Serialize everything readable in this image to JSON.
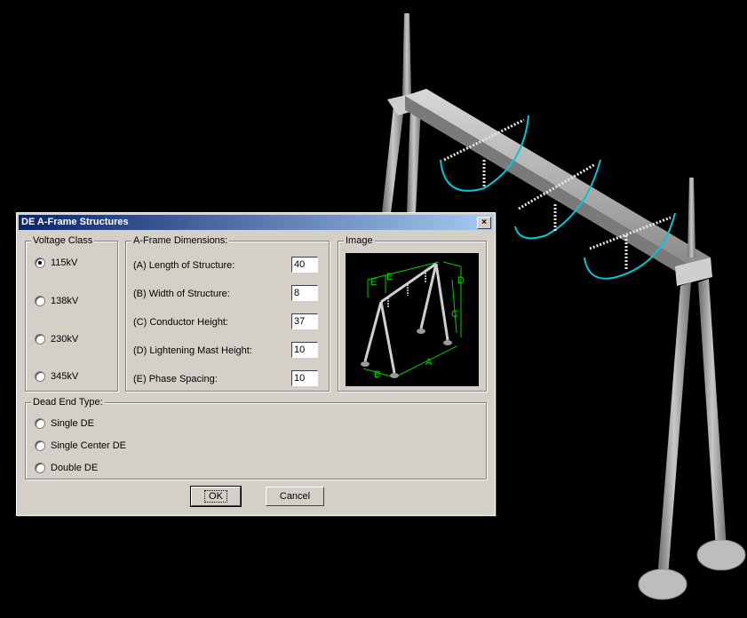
{
  "dialog": {
    "title": "DE A-Frame Structures",
    "close_glyph": "×",
    "voltage_class": {
      "label": "Voltage Class",
      "options": [
        "115kV",
        "138kV",
        "230kV",
        "345kV"
      ],
      "selected": "115kV"
    },
    "dimensions": {
      "label": "A-Frame Dimensions:",
      "rows": [
        {
          "label": "(A) Length of Structure:",
          "value": "40"
        },
        {
          "label": "(B) Width of Structure:",
          "value": "8"
        },
        {
          "label": "(C) Conductor Height:",
          "value": "37"
        },
        {
          "label": "(D) Lightening Mast Height:",
          "value": "10"
        },
        {
          "label": "(E) Phase Spacing:",
          "value": "10"
        }
      ]
    },
    "image_group": {
      "label": "Image",
      "diagram_letters": [
        "E",
        "E",
        "D",
        "C",
        "A",
        "B"
      ]
    },
    "dead_end": {
      "label": "Dead End Type:",
      "options": [
        "Single DE",
        "Single Center DE",
        "Double DE"
      ]
    },
    "ok_label": "OK",
    "cancel_label": "Cancel"
  },
  "colors": {
    "titlebar_start": "#0a246a",
    "dialog_face": "#d4d0c8",
    "diagram_dim_lines": "#00cc00",
    "insulator_swing": "#00c8d8"
  }
}
